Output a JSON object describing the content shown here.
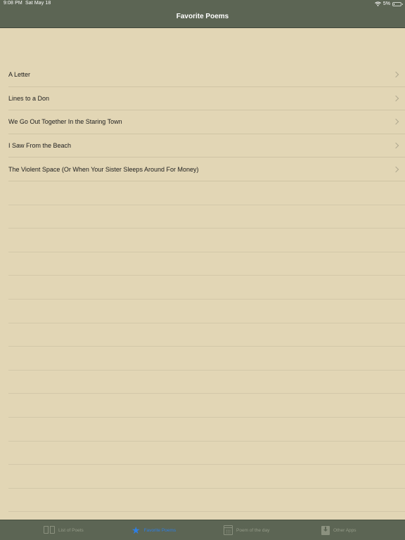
{
  "status_bar": {
    "time": "9:08 PM",
    "date": "Sat May 18",
    "battery": "5%",
    "battery_level": 0.05
  },
  "nav": {
    "title": "Favorite Poems"
  },
  "poems": [
    {
      "title": "A Letter"
    },
    {
      "title": "Lines to a Don"
    },
    {
      "title": "We Go Out Together In the Staring Town"
    },
    {
      "title": "I Saw From the Beach"
    },
    {
      "title": "The Violent Space (Or When Your Sister Sleeps Around For Money)"
    }
  ],
  "tabs": [
    {
      "label": "List of Poets",
      "icon": "book-icon",
      "active": false
    },
    {
      "label": "Favorite Poems",
      "icon": "star-icon",
      "active": true
    },
    {
      "label": "Poem of the day",
      "icon": "calendar-icon",
      "active": false
    },
    {
      "label": "Other Apps",
      "icon": "download-icon",
      "active": false
    }
  ],
  "colors": {
    "bar": "#5c6554",
    "background": "#e2d6b5",
    "accent": "#2d7fe6"
  }
}
